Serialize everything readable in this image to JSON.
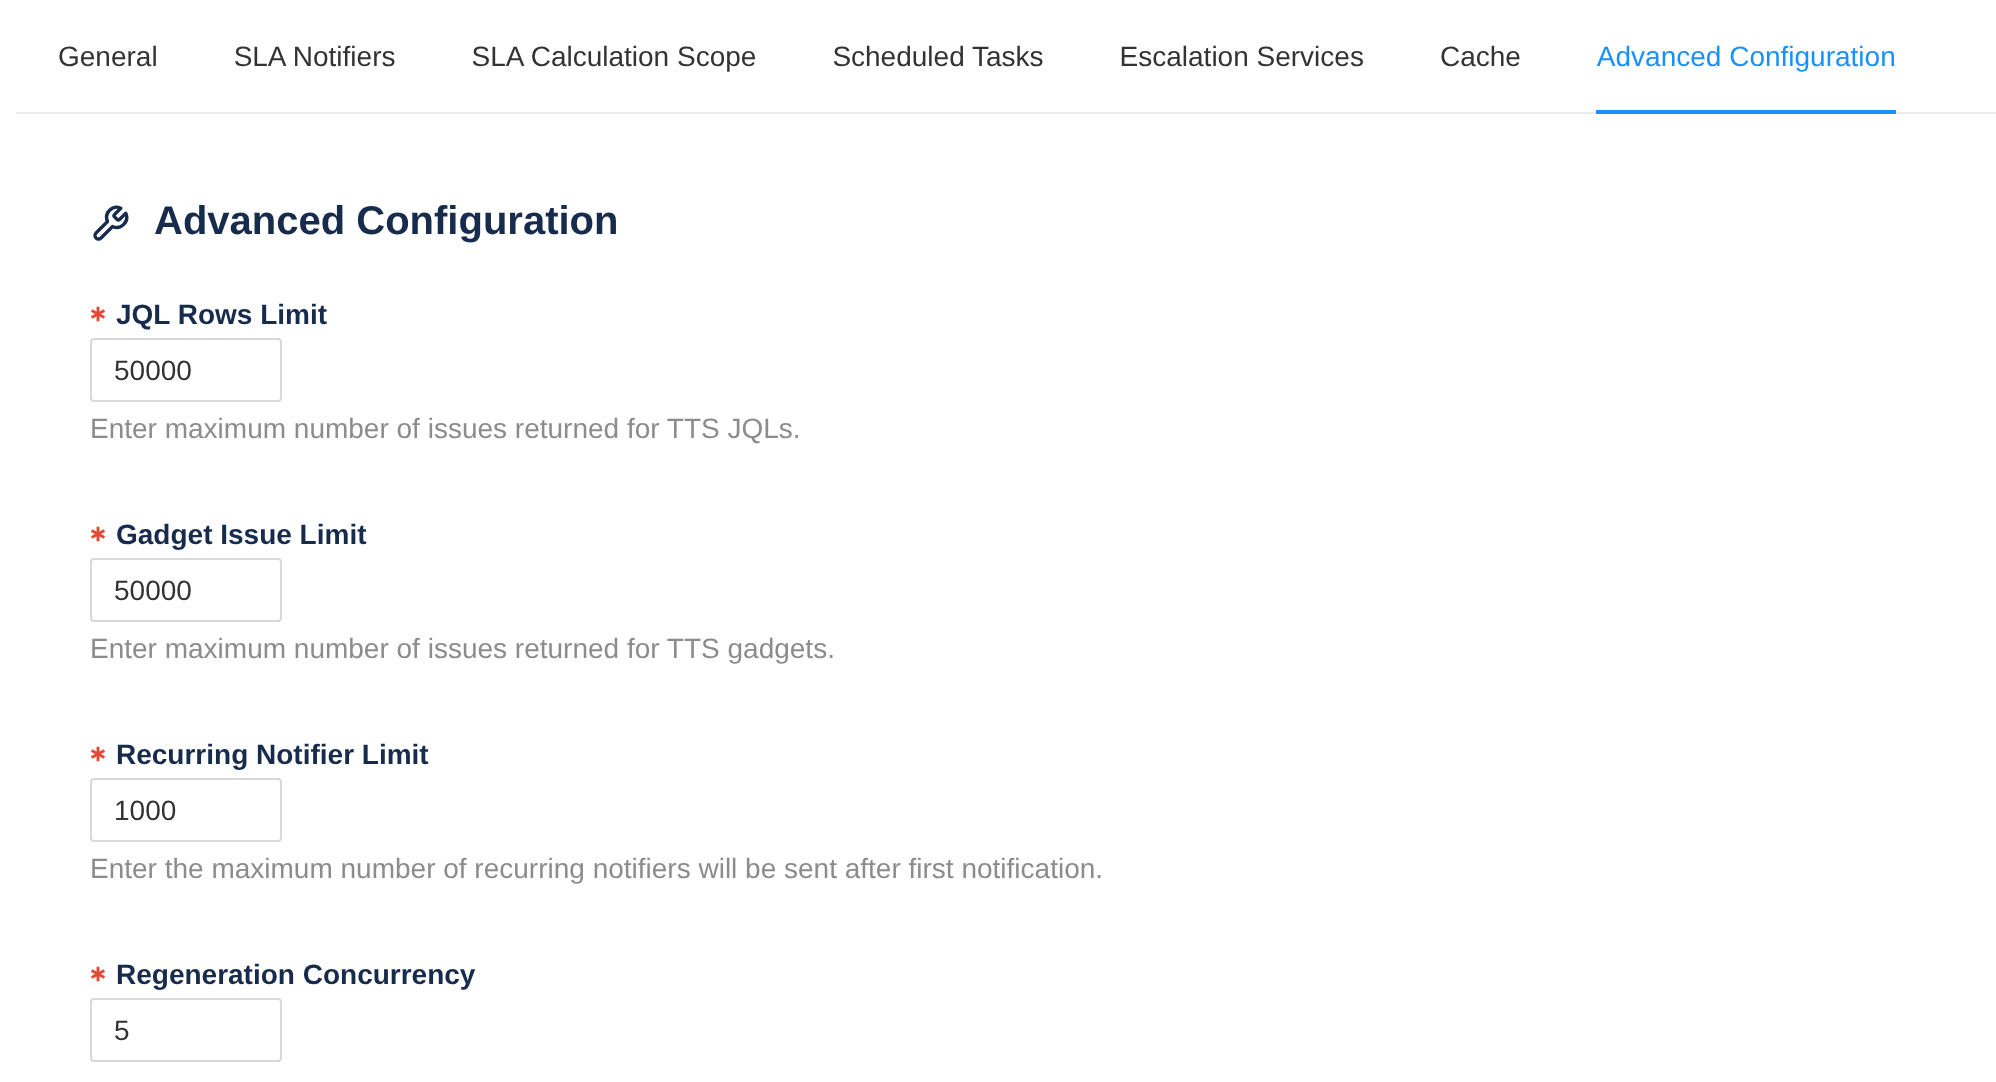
{
  "tabs": [
    {
      "label": "General",
      "selected": false
    },
    {
      "label": "SLA Notifiers",
      "selected": false
    },
    {
      "label": "SLA Calculation Scope",
      "selected": false
    },
    {
      "label": "Scheduled Tasks",
      "selected": false
    },
    {
      "label": "Escalation Services",
      "selected": false
    },
    {
      "label": "Cache",
      "selected": false
    },
    {
      "label": "Advanced Configuration",
      "selected": true
    }
  ],
  "section": {
    "title": "Advanced Configuration"
  },
  "fields": [
    {
      "label": "JQL Rows Limit",
      "required": true,
      "value": "50000",
      "help": "Enter maximum number of issues returned for TTS JQLs."
    },
    {
      "label": "Gadget Issue Limit",
      "required": true,
      "value": "50000",
      "help": "Enter maximum number of issues returned for TTS gadgets."
    },
    {
      "label": "Recurring Notifier Limit",
      "required": true,
      "value": "1000",
      "help": "Enter the maximum number of recurring notifiers will be sent after first notification."
    },
    {
      "label": "Regeneration Concurrency",
      "required": true,
      "value": "5"
    }
  ]
}
